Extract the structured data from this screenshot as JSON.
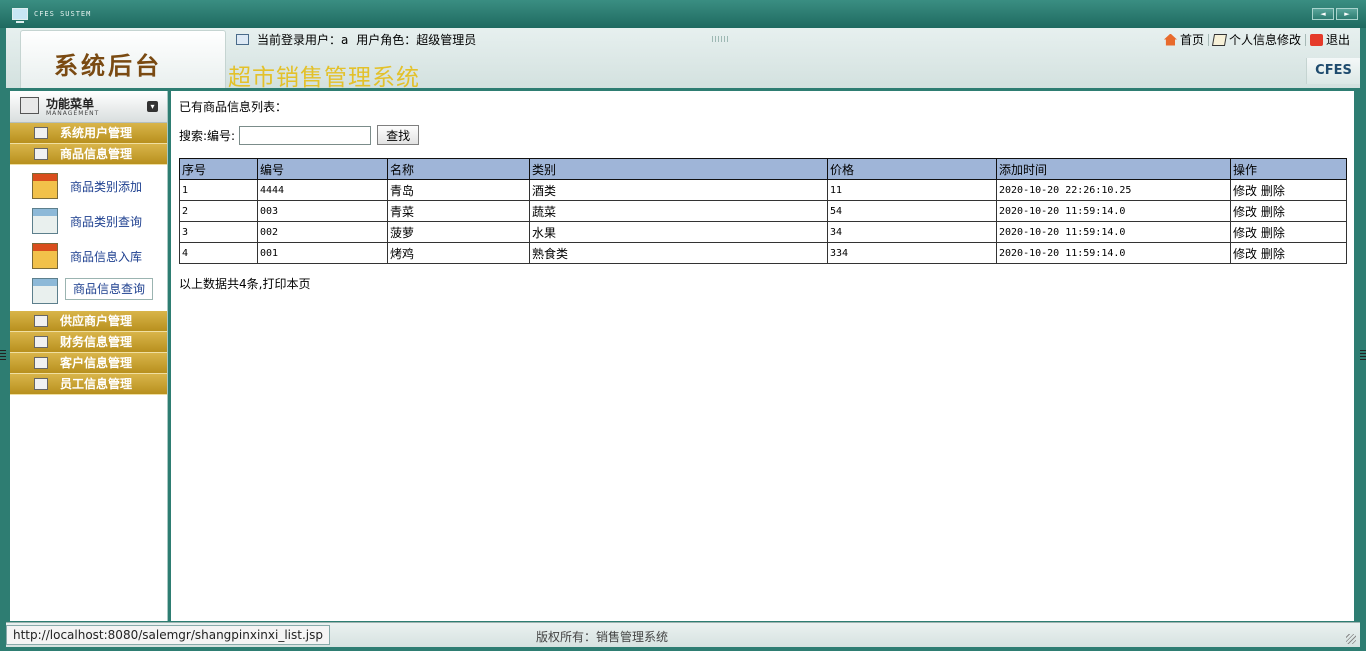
{
  "window": {
    "title": "CFES SUSTEM",
    "btn_prev": "◄",
    "btn_next": "►"
  },
  "header": {
    "logo": "系统后台",
    "system_name": "超市销售管理系统",
    "badge": "CFES",
    "user_label": "当前登录用户：a",
    "role_label": "用户角色：超级管理员",
    "links": {
      "home": "首页",
      "profile": "个人信息修改",
      "logout": "退出"
    }
  },
  "sidebar": {
    "menu_title": "功能菜单",
    "menu_sub": "MANAGEMENT",
    "groups_top": [
      {
        "label": "系统用户管理"
      },
      {
        "label": "商品信息管理"
      }
    ],
    "sub_items": [
      {
        "label": "商品类别添加",
        "icon": "red"
      },
      {
        "label": "商品类别查询",
        "icon": "blue"
      },
      {
        "label": "商品信息入库",
        "icon": "red"
      },
      {
        "label": "商品信息查询",
        "icon": "blue",
        "active": true
      }
    ],
    "groups_bottom": [
      {
        "label": "供应商户管理"
      },
      {
        "label": "财务信息管理"
      },
      {
        "label": "客户信息管理"
      },
      {
        "label": "员工信息管理"
      }
    ]
  },
  "main": {
    "list_title": "已有商品信息列表：",
    "search_label": "搜索:编号:",
    "search_value": "",
    "search_button": "查找",
    "columns": [
      "序号",
      "编号",
      "名称",
      "类别",
      "价格",
      "添加时间",
      "操作"
    ],
    "rows": [
      {
        "no": "1",
        "code": "4444",
        "name": "青岛",
        "category": "酒类",
        "price": "11",
        "time": "2020-10-20 22:26:10.25"
      },
      {
        "no": "2",
        "code": "003",
        "name": "青菜",
        "category": "蔬菜",
        "price": "54",
        "time": "2020-10-20 11:59:14.0"
      },
      {
        "no": "3",
        "code": "002",
        "name": "菠萝",
        "category": "水果",
        "price": "34",
        "time": "2020-10-20 11:59:14.0"
      },
      {
        "no": "4",
        "code": "001",
        "name": "烤鸡",
        "category": "熟食类",
        "price": "334",
        "time": "2020-10-20 11:59:14.0"
      }
    ],
    "action_edit": "修改",
    "action_delete": "删除",
    "count_text": "以上数据共4条,",
    "print_link": "打印本页"
  },
  "status": {
    "url": "http://localhost:8080/salemgr/shangpinxinxi_list.jsp",
    "copyright": "版权所有：销售管理系统"
  }
}
